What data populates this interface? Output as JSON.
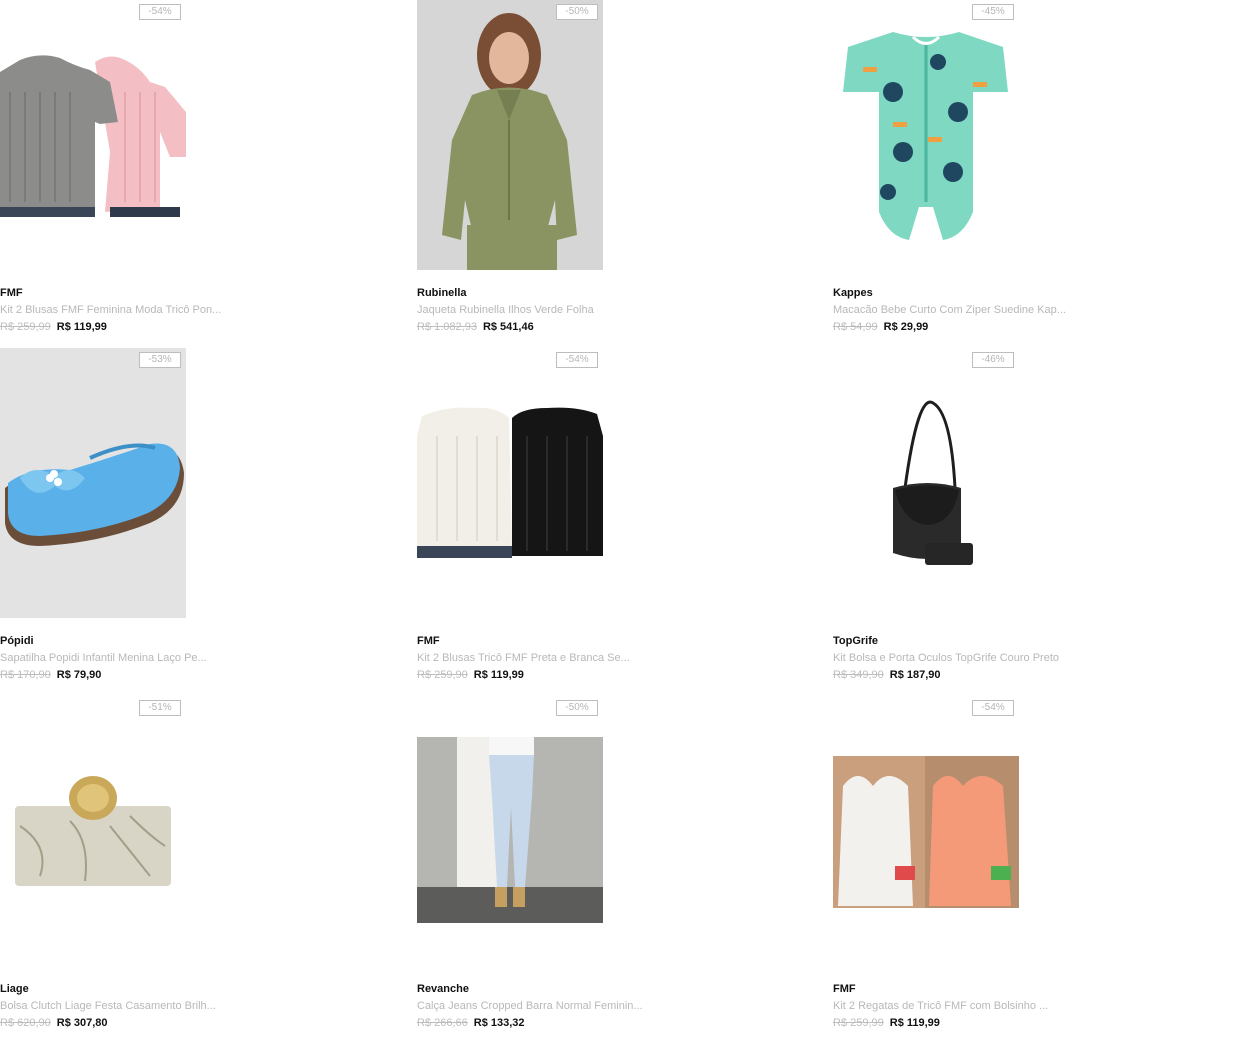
{
  "products": [
    {
      "discount": "-54%",
      "brand": "FMF",
      "name": "Kit 2 Blusas FMF Feminina Moda Tricô Pon...",
      "old_price": "R$ 259,99",
      "price": "R$ 119,99",
      "image": "two-cable-knit-sweaters-image"
    },
    {
      "discount": "-50%",
      "brand": "Rubinella",
      "name": "Jaqueta Rubinella Ilhos Verde Folha",
      "old_price": "R$ 1.082,93",
      "price": "R$ 541,46",
      "image": "green-jacket-model-image"
    },
    {
      "discount": "-45%",
      "brand": "Kappes",
      "name": "Macacão Bebe Curto Com Ziper Suedine Kap...",
      "old_price": "R$ 54,99",
      "price": "R$ 29,99",
      "image": "baby-romper-image"
    },
    {
      "discount": "-53%",
      "brand": "Pópidi",
      "name": "Sapatilha Popidi Infantil Menina Laço Pe...",
      "old_price": "R$ 170,90",
      "price": "R$ 79,90",
      "image": "blue-girls-shoe-image"
    },
    {
      "discount": "-54%",
      "brand": "FMF",
      "name": "Kit 2 Blusas Tricô FMF Preta e Branca Se...",
      "old_price": "R$ 259,90",
      "price": "R$ 119,99",
      "image": "white-black-knit-tops-image"
    },
    {
      "discount": "-46%",
      "brand": "TopGrife",
      "name": "Kit Bolsa e Porta Oculos TopGrife Couro Preto",
      "old_price": "R$ 349,90",
      "price": "R$ 187,90",
      "image": "black-leather-bag-image"
    },
    {
      "discount": "-51%",
      "brand": "Liage",
      "name": "Bolsa Clutch Liage Festa Casamento Brilh...",
      "old_price": "R$ 620,90",
      "price": "R$ 307,80",
      "image": "marble-clutch-image"
    },
    {
      "discount": "-50%",
      "brand": "Revanche",
      "name": "Calça Jeans Cropped Barra Normal Feminin...",
      "old_price": "R$ 266,66",
      "price": "R$ 133,32",
      "image": "light-jeans-image"
    },
    {
      "discount": "-54%",
      "brand": "FMF",
      "name": "Kit 2 Regatas de Tricô FMF com Bolsinho ...",
      "old_price": "R$ 259,99",
      "price": "R$ 119,99",
      "image": "white-coral-tank-tops-image"
    }
  ]
}
